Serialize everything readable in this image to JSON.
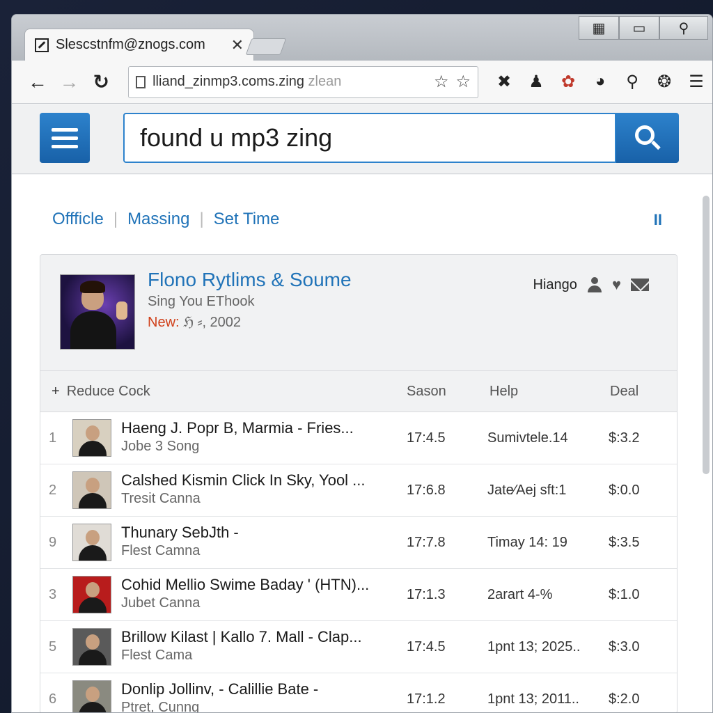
{
  "browser": {
    "tab_title": "Slescstnfm@znogs.com",
    "tab_close": "✕",
    "url_main": "lliand_zinmp3.coms.zing",
    "url_dim": " zlean",
    "window_controls": [
      "▦",
      "▭",
      "⚲"
    ]
  },
  "header": {
    "search_value": "found u mp3 zing"
  },
  "subnav": {
    "items": [
      "Offficle",
      "Massing",
      "Set Time"
    ],
    "pause_label": "II"
  },
  "album": {
    "title": "Flono Rytlims & Soume",
    "artist": "Sing You EThook",
    "new_label": "New:",
    "new_value": " ℌ ⸗, 2002",
    "user_name": "Hiango"
  },
  "table": {
    "headers": {
      "title": "Reduce Cock",
      "season": "Sason",
      "help": "Help",
      "deal": "Deal"
    },
    "rows": [
      {
        "num": "1",
        "track": "Haeng J. Popr B, Marmia - Fries...",
        "artist": "Jobe 3 Song",
        "season": "17:4.5",
        "help": "Sumivtele.14",
        "deal": "$:3.2",
        "thumb_bg": "#d8d0c0"
      },
      {
        "num": "2",
        "track": "Calshed Kismin Click In Sky, Yool ...",
        "artist": "Tresit Canna",
        "season": "17:6.8",
        "help": "Jate⁄Aej sft:1",
        "deal": "$:0.0",
        "thumb_bg": "#cfc6b8"
      },
      {
        "num": "9",
        "track": "Thunary SebJth -",
        "artist": "Flest Camna",
        "season": "17:7.8",
        "help": "Timay 14: 19",
        "deal": "$:3.5",
        "thumb_bg": "#e0dcd6"
      },
      {
        "num": "3",
        "track": "Cohid Mellio Swime Baday ' (HTN)...",
        "artist": "Jubet Canna",
        "season": "17:1.3",
        "help": "2arart 4-%",
        "deal": "$:1.0",
        "thumb_bg": "#b81c1c"
      },
      {
        "num": "5",
        "track": "Brillow Kilast | Kallo 7. Mall - Clap...",
        "artist": "Flest Cama",
        "season": "17:4.5",
        "help": "1pnt 13; 2025..",
        "deal": "$:3.0",
        "thumb_bg": "#5a5a5a"
      },
      {
        "num": "6",
        "track": "Donlip Jollinv, - Calillie Bate -",
        "artist": "Ptret, Cunng",
        "season": "17:1.2",
        "help": "1pnt 13; 2011..",
        "deal": "$:2.0",
        "thumb_bg": "#8a8a80"
      }
    ]
  },
  "colors": {
    "accent": "#2073b8",
    "button_blue": "#1861a8",
    "new_label": "#d0401a"
  }
}
